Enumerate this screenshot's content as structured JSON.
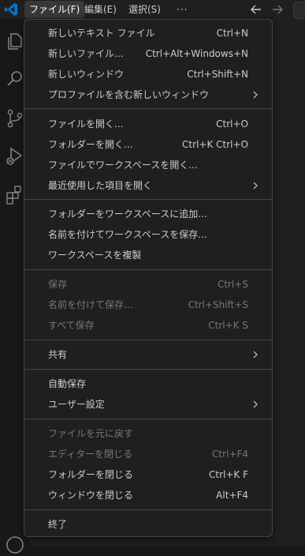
{
  "menubar": {
    "file": "ファイル(F)",
    "edit": "編集(E)",
    "selection": "選択(S)",
    "more": "···"
  },
  "file_menu": {
    "new_text_file": {
      "label": "新しいテキスト ファイル",
      "kb": "Ctrl+N"
    },
    "new_file": {
      "label": "新しいファイル...",
      "kb": "Ctrl+Alt+Windows+N"
    },
    "new_window": {
      "label": "新しいウィンドウ",
      "kb": "Ctrl+Shift+N"
    },
    "new_window_profile": {
      "label": "プロファイルを含む新しいウィンドウ"
    },
    "open_file": {
      "label": "ファイルを開く...",
      "kb": "Ctrl+O"
    },
    "open_folder": {
      "label": "フォルダーを開く...",
      "kb": "Ctrl+K Ctrl+O"
    },
    "open_workspace": {
      "label": "ファイルでワークスペースを開く..."
    },
    "open_recent": {
      "label": "最近使用した項目を開く"
    },
    "add_folder": {
      "label": "フォルダーをワークスペースに追加..."
    },
    "save_workspace_as": {
      "label": "名前を付けてワークスペースを保存..."
    },
    "duplicate_workspace": {
      "label": "ワークスペースを複製"
    },
    "save": {
      "label": "保存",
      "kb": "Ctrl+S"
    },
    "save_as": {
      "label": "名前を付けて保存...",
      "kb": "Ctrl+Shift+S"
    },
    "save_all": {
      "label": "すべて保存",
      "kb": "Ctrl+K S"
    },
    "share": {
      "label": "共有"
    },
    "auto_save": {
      "label": "自動保存"
    },
    "preferences": {
      "label": "ユーザー設定"
    },
    "revert_file": {
      "label": "ファイルを元に戻す"
    },
    "close_editor": {
      "label": "エディターを閉じる",
      "kb": "Ctrl+F4"
    },
    "close_folder": {
      "label": "フォルダーを閉じる",
      "kb": "Ctrl+K F"
    },
    "close_window": {
      "label": "ウィンドウを閉じる",
      "kb": "Alt+F4"
    },
    "exit": {
      "label": "終了"
    }
  },
  "colors": {
    "accent": "#0078d4",
    "menu_bg": "#1f1f1f",
    "separator": "#454545",
    "disabled_text": "#777777"
  }
}
